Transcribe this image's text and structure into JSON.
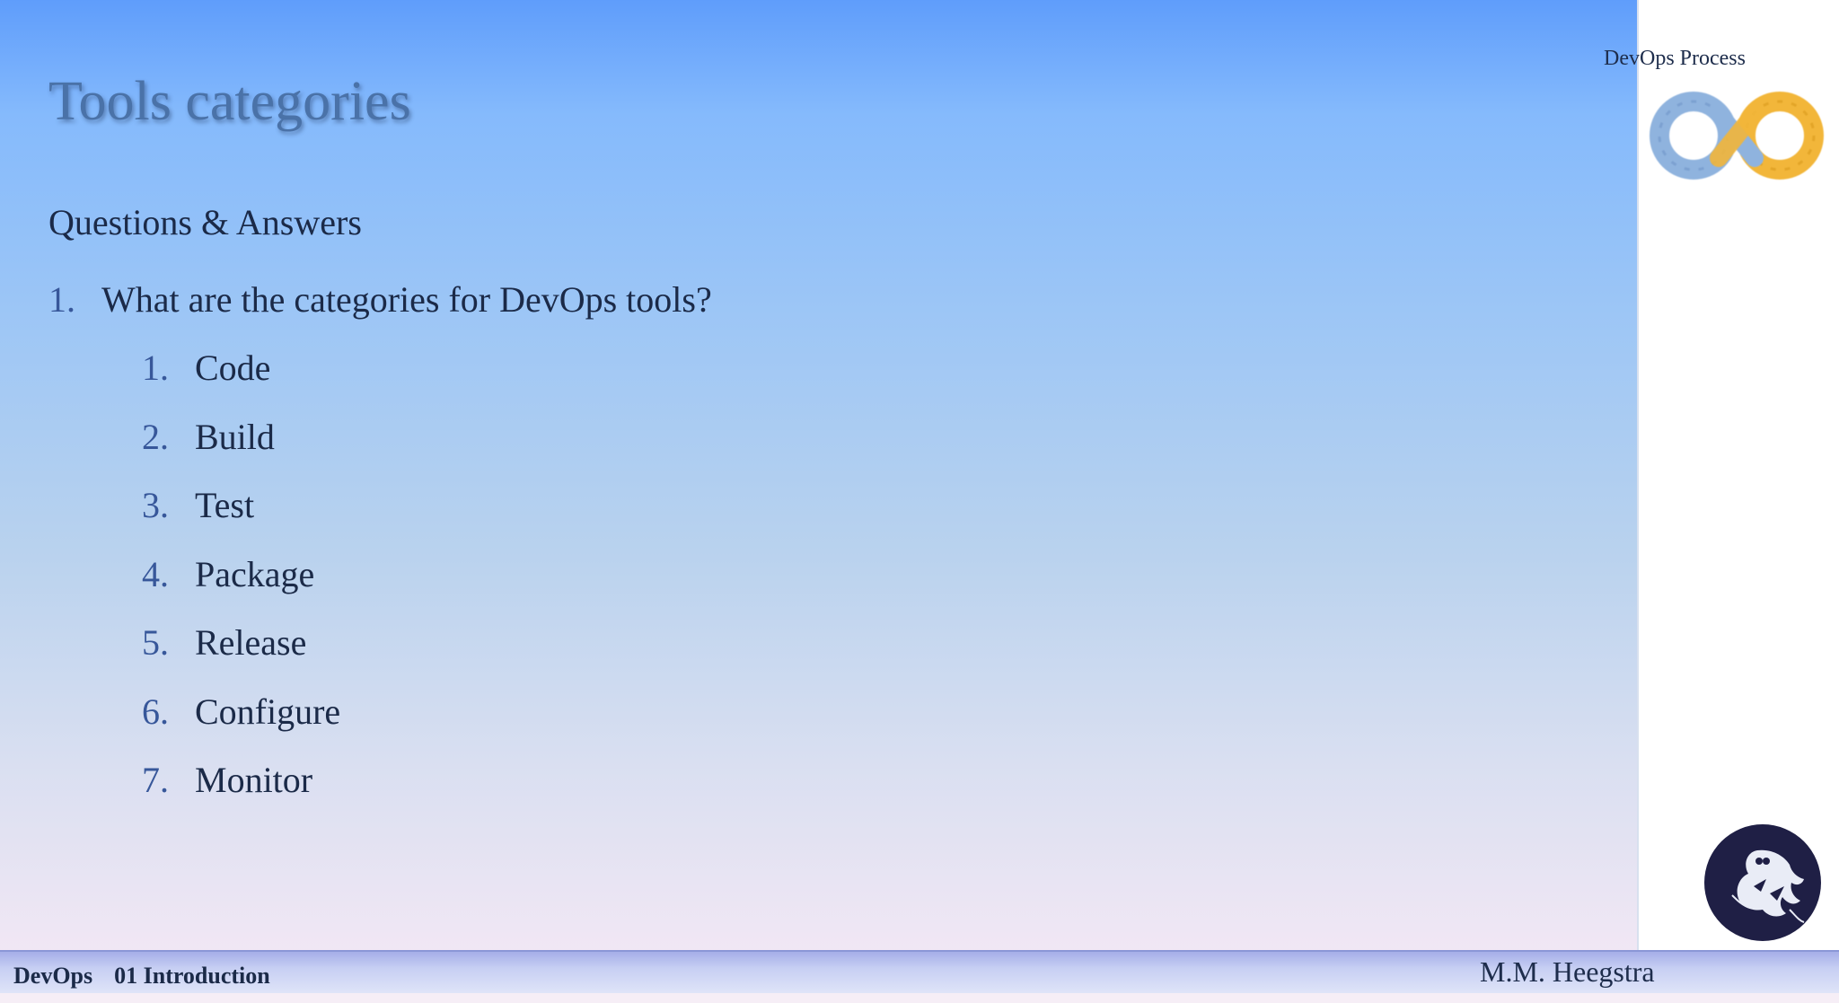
{
  "slide": {
    "title": "Tools categories",
    "subtitle": "Questions & Answers",
    "question": {
      "number": "1.",
      "text": "What are the categories for DevOps tools?"
    },
    "answers": [
      {
        "number": "1.",
        "text": "Code"
      },
      {
        "number": "2.",
        "text": "Build"
      },
      {
        "number": "3.",
        "text": "Test"
      },
      {
        "number": "4.",
        "text": "Package"
      },
      {
        "number": "5.",
        "text": "Release"
      },
      {
        "number": "6.",
        "text": "Configure"
      },
      {
        "number": "7.",
        "text": "Monitor"
      }
    ]
  },
  "side_panel": {
    "label": "DevOps Process",
    "logo_icon": "devops-infinity-loop-icon",
    "avatar_icon": "eagle-emblem-icon"
  },
  "footer": {
    "course": "DevOps",
    "chapter": "01 Introduction",
    "author": "M.M. Heegstra"
  },
  "colors": {
    "title": "#4a72a8",
    "body_text": "#1b2a48",
    "list_number": "#37579a",
    "loop_blue": "#8fb3de",
    "loop_yellow": "#f2b63a",
    "avatar_bg": "#1f1f45"
  }
}
